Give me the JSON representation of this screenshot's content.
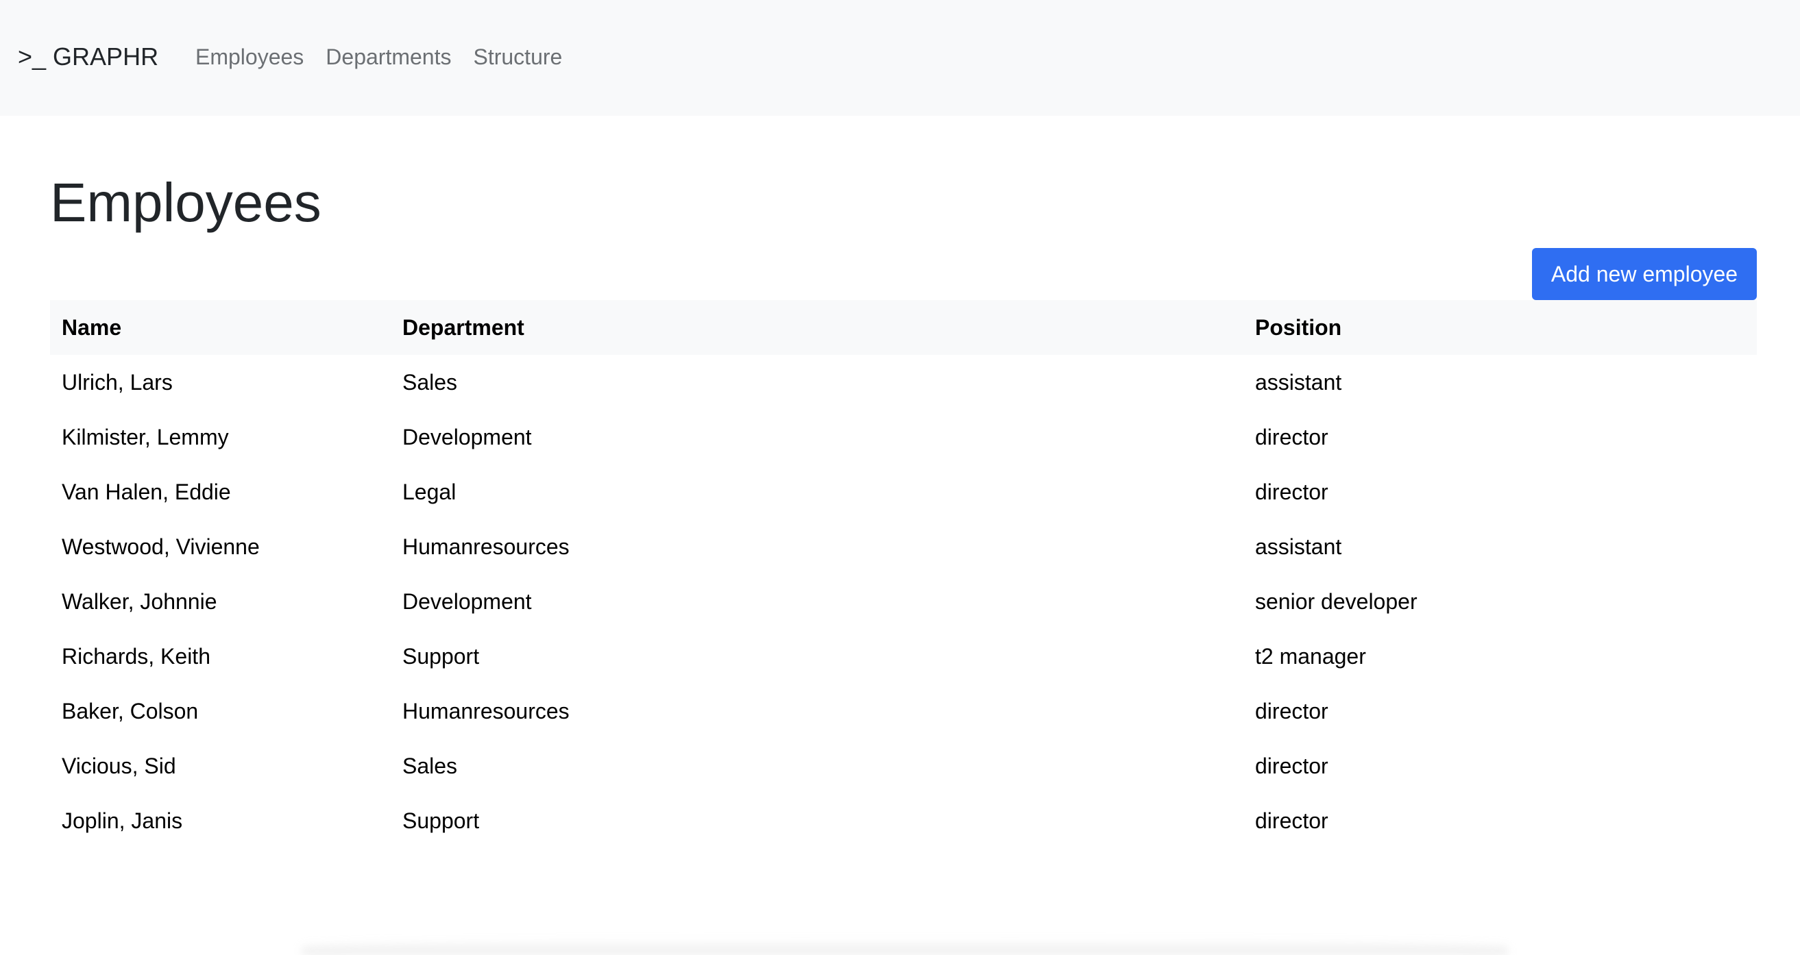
{
  "navbar": {
    "brand": ">_ GRAPHR",
    "links": [
      "Employees",
      "Departments",
      "Structure"
    ]
  },
  "page": {
    "title": "Employees",
    "add_button_label": "Add new employee"
  },
  "table": {
    "headers": [
      "Name",
      "Department",
      "Position"
    ],
    "rows": [
      [
        "Ulrich, Lars",
        "Sales",
        "assistant"
      ],
      [
        "Kilmister, Lemmy",
        "Development",
        "director"
      ],
      [
        "Van Halen, Eddie",
        "Legal",
        "director"
      ],
      [
        "Westwood, Vivienne",
        "Humanresources",
        "assistant"
      ],
      [
        "Walker, Johnnie",
        "Development",
        "senior developer"
      ],
      [
        "Richards, Keith",
        "Support",
        "t2 manager"
      ],
      [
        "Baker, Colson",
        "Humanresources",
        "director"
      ],
      [
        "Vicious, Sid",
        "Sales",
        "director"
      ],
      [
        "Joplin, Janis",
        "Support",
        "director"
      ]
    ]
  },
  "colors": {
    "navbar_bg": "#f8f9fa",
    "primary_button": "#2f6ef2",
    "table_header_bg": "#f8f9fa"
  }
}
